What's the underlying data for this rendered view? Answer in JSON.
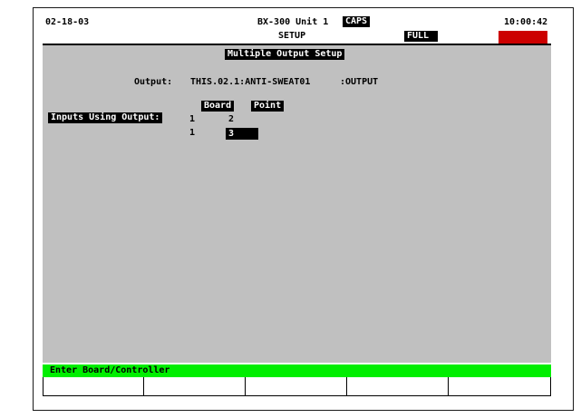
{
  "header": {
    "date": "02-18-03",
    "unit": "BX-300 Unit 1",
    "caps_badge": "CAPS",
    "time": "10:00:42",
    "screen": "SETUP",
    "full_badge": "FULL",
    "alarm_color": "#cc0000"
  },
  "main": {
    "title": "Multiple Output Setup",
    "output_label": "Output:",
    "output_value": "THIS.02.1:ANTI-SWEAT01",
    "output_type": ":OUTPUT",
    "col_board": "Board",
    "col_point": "Point",
    "inputs_label": "Inputs Using Output:",
    "rows": [
      {
        "board": "1",
        "point": "2"
      },
      {
        "board": "1",
        "point": "3"
      }
    ]
  },
  "status": {
    "message": "Enter Board/Controller",
    "color": "#00ee00"
  },
  "function_keys": [
    "",
    "",
    "",
    "",
    ""
  ]
}
